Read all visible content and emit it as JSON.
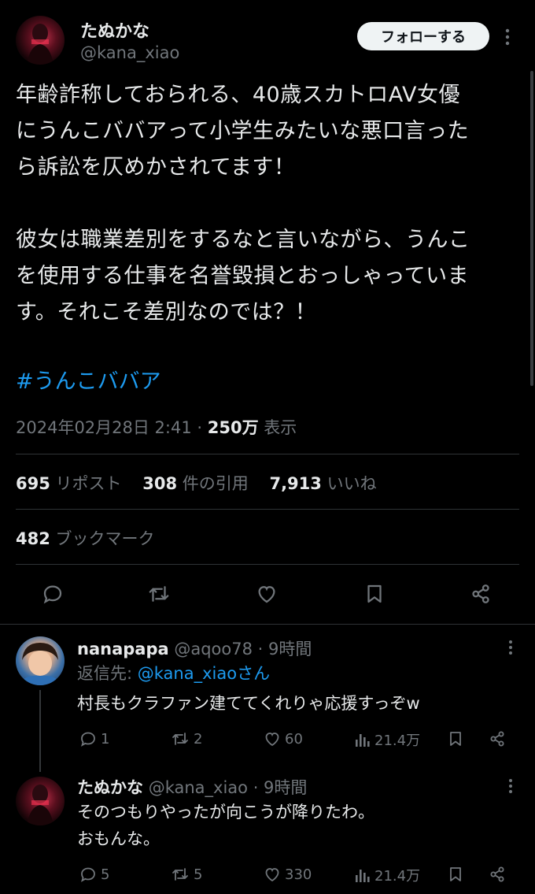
{
  "tweet": {
    "author_name": "たぬかな",
    "author_handle": "@kana_xiao",
    "follow_label": "フォローする",
    "body": "年齢詐称しておられる、40歳スカトロAV女優\nにうんこババアって小学生みたいな悪口言った\nら訴訟を仄めかされてます！\n\n彼女は職業差別をするなと言いながら、うんこ\nを使用する仕事を名誉毀損とおっしゃっていま\nす。それこそ差別なのでは？！",
    "hashtag": "#うんこババア",
    "timestamp": "2024年02月28日 2:41",
    "views_count": "250万",
    "views_label": "表示",
    "reposts_count": "695",
    "reposts_label": "リポスト",
    "quotes_count": "308",
    "quotes_label": "件の引用",
    "likes_count": "7,913",
    "likes_label": "いいね",
    "bookmarks_count": "482",
    "bookmarks_label": "ブックマーク"
  },
  "replies": [
    {
      "name": "nanapapa",
      "handle": "@aqoo78",
      "time": "· 9時間",
      "reply_to_label": "返信先:",
      "reply_to_handle": "@kana_xiaoさん",
      "text": "村長もクラファン建ててくれりゃ応援すっぞw",
      "replies": "1",
      "reposts": "2",
      "likes": "60",
      "views": "21.4万"
    },
    {
      "name": "たぬかな",
      "handle": "@kana_xiao",
      "time": "· 9時間",
      "text": "そのつもりやったが向こうが降りたわ。\nおもんな。",
      "replies": "5",
      "reposts": "5",
      "likes": "330",
      "views": "21.4万"
    }
  ],
  "colors": {
    "background": "#000000",
    "text": "#e7e9ea",
    "secondary": "#71767b",
    "link": "#1d9bf0",
    "divider": "#2f3336"
  }
}
